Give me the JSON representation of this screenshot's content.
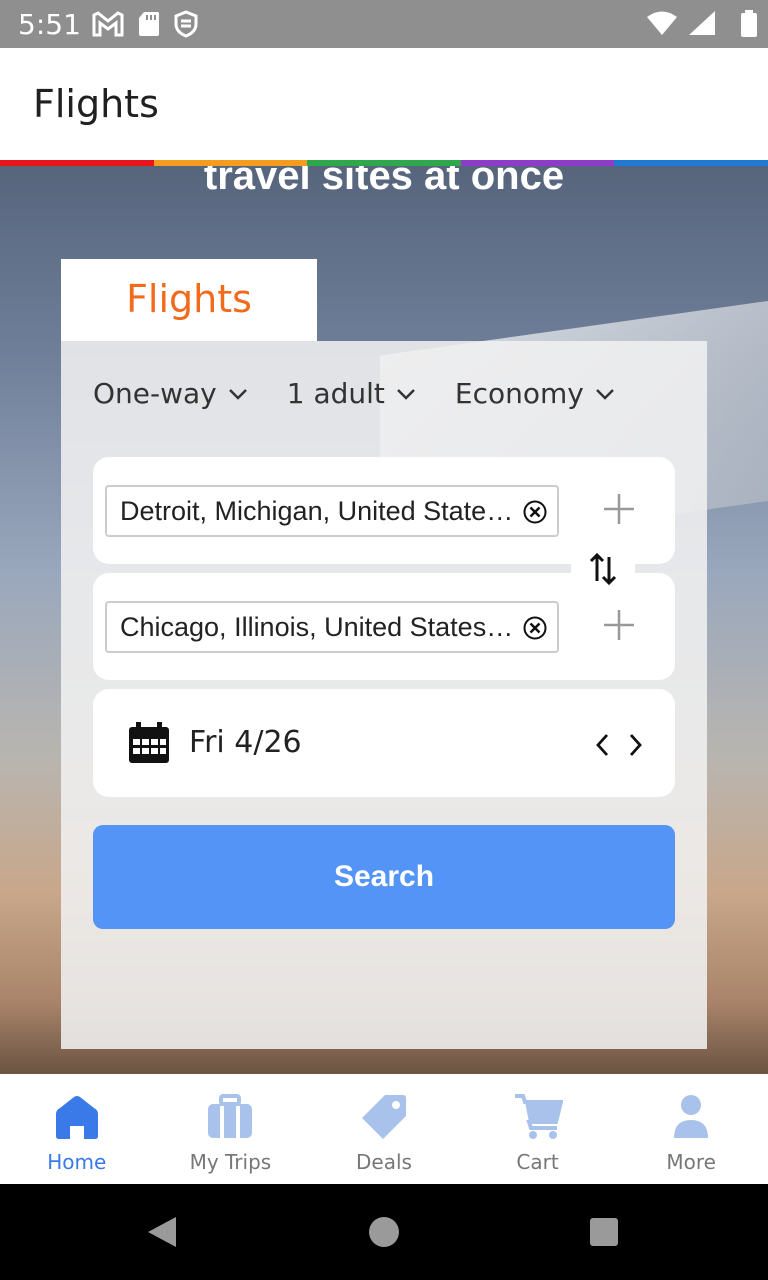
{
  "status_bar": {
    "time": "5:51",
    "left_icons": [
      "gmail-icon",
      "sd-card-icon",
      "vpn-icon"
    ],
    "right_icons": [
      "wifi-icon",
      "signal-icon",
      "battery-icon"
    ]
  },
  "app_bar": {
    "title": "Flights"
  },
  "rainbow_colors": [
    "#e8141c",
    "#f39c1e",
    "#2ea84a",
    "#8e3bc9",
    "#1f7ad6"
  ],
  "hero": {
    "text": "travel sites at once"
  },
  "tab": {
    "label": "Flights"
  },
  "search_form": {
    "trip_type": "One-way",
    "travelers": "1 adult",
    "cabin": "Economy",
    "origin": "Detroit, Michigan, United States (DTW)",
    "destination": "Chicago, Illinois, United States (CHI)",
    "date": "Fri 4/26",
    "search_label": "Search"
  },
  "bottom_nav": {
    "items": [
      {
        "label": "Home",
        "icon": "home-icon",
        "active": true
      },
      {
        "label": "My Trips",
        "icon": "briefcase-icon",
        "active": false
      },
      {
        "label": "Deals",
        "icon": "tag-icon",
        "active": false
      },
      {
        "label": "Cart",
        "icon": "cart-icon",
        "active": false
      },
      {
        "label": "More",
        "icon": "person-icon",
        "active": false
      }
    ]
  },
  "colors": {
    "accent_orange": "#f26b1d",
    "search_button": "#5594f7",
    "nav_active": "#3a7ae8",
    "nav_inactive": "#a9c2ec"
  }
}
